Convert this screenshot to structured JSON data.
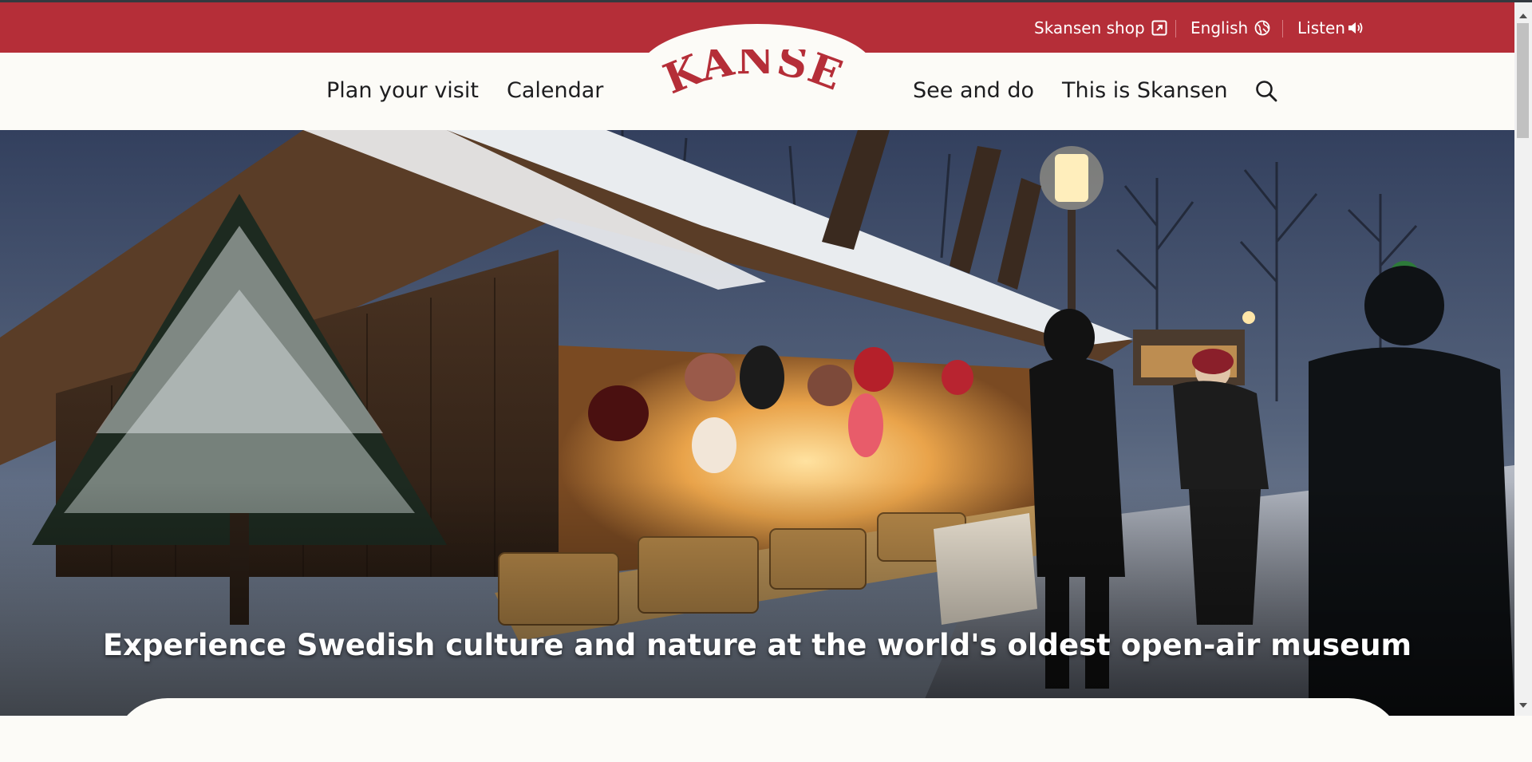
{
  "colors": {
    "brand_red": "#b52e38",
    "nav_bg": "#fcfbf7",
    "text_dark": "#1d1d1f"
  },
  "utility": {
    "shop_label": "Skansen shop",
    "shop_icon": "external-link-icon",
    "language_label": "English",
    "language_icon": "globe-icon",
    "listen_label": "Listen",
    "listen_icon": "speaker-icon"
  },
  "logo": {
    "text": "SKANSEN"
  },
  "nav": {
    "plan": "Plan your visit",
    "calendar": "Calendar",
    "see_and_do": "See and do",
    "this_is": "This is Skansen",
    "search_icon": "search-icon"
  },
  "hero": {
    "headline": "Experience Swedish culture and nature at the world's oldest open-air museum"
  }
}
